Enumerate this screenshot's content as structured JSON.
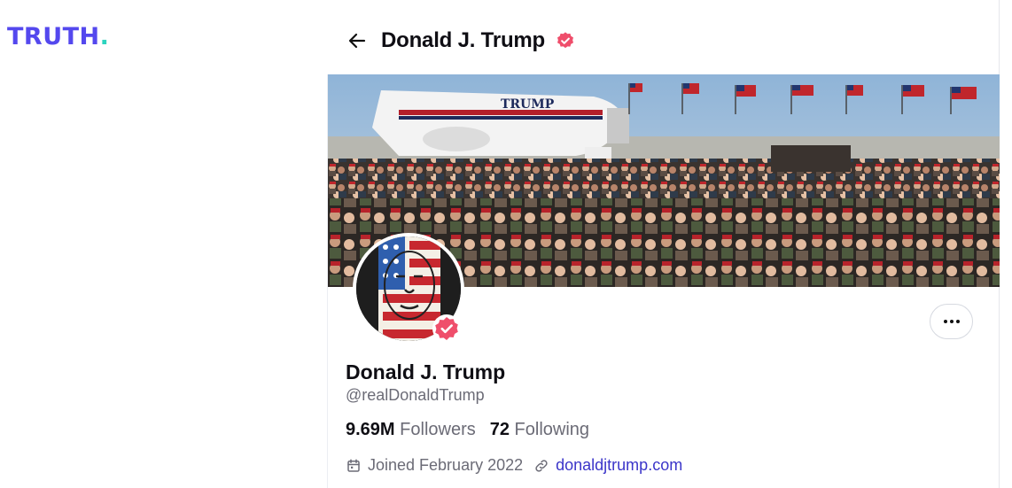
{
  "brand": {
    "logo_text": "TRUTH",
    "logo_dot": "."
  },
  "header": {
    "title": "Donald J. Trump",
    "back_icon": "arrow-left-icon",
    "verified_icon": "verified-badge-icon"
  },
  "banner": {
    "aircraft_text": "TRUMP",
    "description_icon": "rally-photo"
  },
  "profile": {
    "display_name": "Donald J. Trump",
    "handle": "@realDonaldTrump",
    "followers_count": "9.69M",
    "followers_label": "Followers",
    "following_count": "72",
    "following_label": "Following",
    "joined_text": "Joined February 2022",
    "website": "donaldjtrump.com",
    "more_icon": "ellipsis-icon"
  },
  "colors": {
    "brand": "#5448ee",
    "brand_dot": "#2dd4bf",
    "verified": "#ef4e6b",
    "link": "#3b35c9",
    "muted": "#6b6b76"
  }
}
